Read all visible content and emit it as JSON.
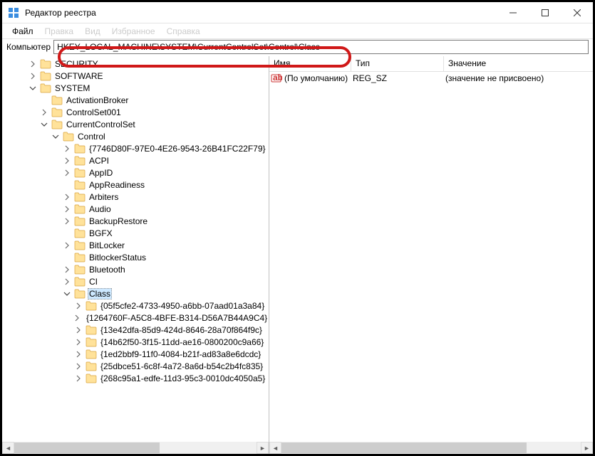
{
  "app": {
    "title": "Редактор реестра"
  },
  "menu": {
    "file": "Файл",
    "edit": "Правка",
    "view": "Вид",
    "favorites": "Избранное",
    "help": "Справка"
  },
  "address": {
    "label": "Компьютер",
    "path": "HKEY_LOCAL_MACHINE\\SYSTEM\\CurrentControlSet\\Control\\Class"
  },
  "tree_top": [
    {
      "indent": 2,
      "label": "SECURITY",
      "expander": "right",
      "overlay": true
    },
    {
      "indent": 2,
      "label": "SOFTWARE",
      "expander": "right"
    },
    {
      "indent": 2,
      "label": "SYSTEM",
      "expander": "down"
    },
    {
      "indent": 3,
      "label": "ActivationBroker",
      "expander": "none"
    },
    {
      "indent": 3,
      "label": "ControlSet001",
      "expander": "right"
    },
    {
      "indent": 3,
      "label": "CurrentControlSet",
      "expander": "down"
    },
    {
      "indent": 4,
      "label": "Control",
      "expander": "down"
    },
    {
      "indent": 5,
      "label": "{7746D80F-97E0-4E26-9543-26B41FC22F79}",
      "expander": "right"
    },
    {
      "indent": 5,
      "label": "ACPI",
      "expander": "right"
    },
    {
      "indent": 5,
      "label": "AppID",
      "expander": "right"
    },
    {
      "indent": 5,
      "label": "AppReadiness",
      "expander": "none"
    },
    {
      "indent": 5,
      "label": "Arbiters",
      "expander": "right"
    },
    {
      "indent": 5,
      "label": "Audio",
      "expander": "right"
    },
    {
      "indent": 5,
      "label": "BackupRestore",
      "expander": "right"
    },
    {
      "indent": 5,
      "label": "BGFX",
      "expander": "none"
    },
    {
      "indent": 5,
      "label": "BitLocker",
      "expander": "right"
    },
    {
      "indent": 5,
      "label": "BitlockerStatus",
      "expander": "none"
    },
    {
      "indent": 5,
      "label": "Bluetooth",
      "expander": "right"
    },
    {
      "indent": 5,
      "label": "CI",
      "expander": "right"
    },
    {
      "indent": 5,
      "label": "Class",
      "expander": "down",
      "selected": true
    },
    {
      "indent": 6,
      "label": "{05f5cfe2-4733-4950-a6bb-07aad01a3a84}",
      "expander": "right"
    },
    {
      "indent": 6,
      "label": "{1264760F-A5C8-4BFE-B314-D56A7B44A9C4}",
      "expander": "right"
    },
    {
      "indent": 6,
      "label": "{13e42dfa-85d9-424d-8646-28a70f864f9c}",
      "expander": "right"
    },
    {
      "indent": 6,
      "label": "{14b62f50-3f15-11dd-ae16-0800200c9a66}",
      "expander": "right"
    },
    {
      "indent": 6,
      "label": "{1ed2bbf9-11f0-4084-b21f-ad83a8e6dcdc}",
      "expander": "right"
    },
    {
      "indent": 6,
      "label": "{25dbce51-6c8f-4a72-8a6d-b54c2b4fc835}",
      "expander": "right"
    },
    {
      "indent": 6,
      "label": "{268c95a1-edfe-11d3-95c3-0010dc4050a5}",
      "expander": "right"
    }
  ],
  "list": {
    "cols": {
      "name": "Имя",
      "type": "Тип",
      "data": "Значение"
    },
    "rows": [
      {
        "name": "(По умолчанию)",
        "type": "REG_SZ",
        "data": "(значение не присвоено)"
      }
    ]
  }
}
